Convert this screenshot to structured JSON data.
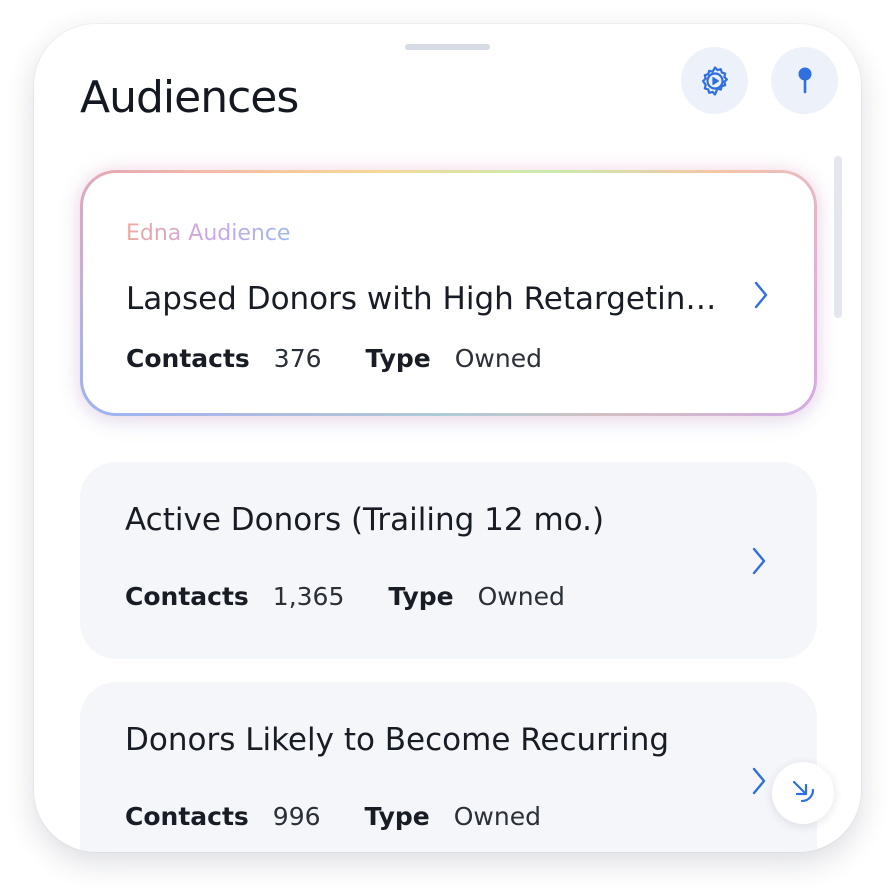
{
  "header": {
    "title": "Audiences",
    "settings_icon": "settings-play-icon",
    "pin_icon": "pin-icon"
  },
  "colors": {
    "accent": "#2f6fe0",
    "icon_button_bg": "#edf1fa",
    "card_bg": "#f4f6fa",
    "text": "#181c24"
  },
  "audiences": [
    {
      "badge": "Edna Audience",
      "name": "Lapsed Donors with High Retargeting Potential",
      "contacts_label": "Contacts",
      "contacts": "376",
      "type_label": "Type",
      "type": "Owned"
    },
    {
      "name": "Active Donors (Trailing 12 mo.)",
      "contacts_label": "Contacts",
      "contacts": "1,365",
      "type_label": "Type",
      "type": "Owned"
    },
    {
      "name": "Donors Likely to Become Recurring",
      "contacts_label": "Contacts",
      "contacts": "996",
      "type_label": "Type",
      "type": "Owned"
    }
  ],
  "fab": {
    "icon": "arrow-down-right-icon"
  }
}
